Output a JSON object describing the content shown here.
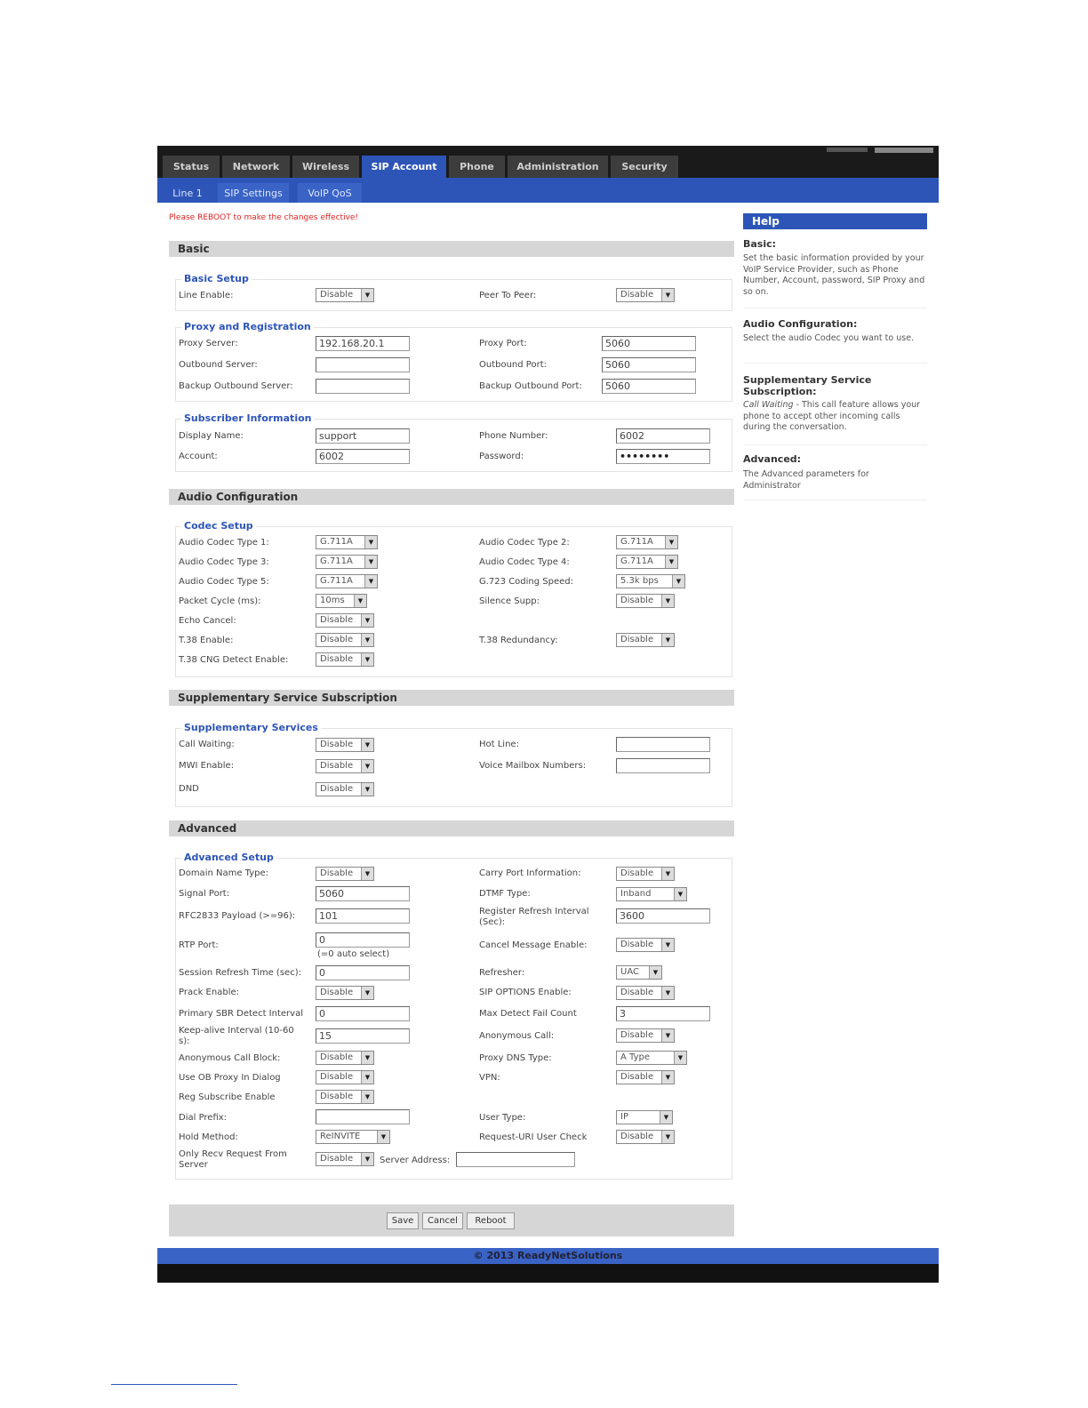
{
  "tabs": [
    "Status",
    "Network",
    "Wireless",
    "SIP Account",
    "Phone",
    "Administration",
    "Security"
  ],
  "subtabs": [
    "Line 1",
    "SIP Settings",
    "VoIP QoS"
  ],
  "notice": "Please REBOOT to make the changes effective!",
  "sections": {
    "basic": "Basic",
    "audio": "Audio Configuration",
    "supp": "Supplementary Service Subscription",
    "advanced": "Advanced"
  },
  "legends": {
    "basic_setup": "Basic Setup",
    "proxy_reg": "Proxy and Registration",
    "subscriber": "Subscriber Information",
    "codec": "Codec Setup",
    "supp_services": "Supplementary Services",
    "adv_setup": "Advanced Setup"
  },
  "basic_setup": {
    "line_enable_label": "Line Enable:",
    "line_enable": "Disable",
    "p2p_label": "Peer To Peer:",
    "p2p": "Disable"
  },
  "proxy": {
    "proxy_server_label": "Proxy Server:",
    "proxy_server": "192.168.20.1",
    "proxy_port_label": "Proxy Port:",
    "proxy_port": "5060",
    "outbound_server_label": "Outbound Server:",
    "outbound_server": "",
    "outbound_port_label": "Outbound Port:",
    "outbound_port": "5060",
    "backup_server_label": "Backup Outbound Server:",
    "backup_server": "",
    "backup_port_label": "Backup Outbound Port:",
    "backup_port": "5060"
  },
  "subscriber": {
    "display_name_label": "Display Name:",
    "display_name": "support",
    "phone_number_label": "Phone Number:",
    "phone_number": "6002",
    "account_label": "Account:",
    "account": "6002",
    "password_label": "Password:",
    "password": "••••••••"
  },
  "codec": {
    "c1_label": "Audio Codec Type 1:",
    "c1": "G.711A",
    "c2_label": "Audio Codec Type 2:",
    "c2": "G.711A",
    "c3_label": "Audio Codec Type 3:",
    "c3": "G.711A",
    "c4_label": "Audio Codec Type 4:",
    "c4": "G.711A",
    "c5_label": "Audio Codec Type 5:",
    "c5": "G.711A",
    "g723_label": "G.723 Coding Speed:",
    "g723": "5.3k bps",
    "packet_label": "Packet Cycle (ms):",
    "packet": "10ms",
    "silence_label": "Silence Supp:",
    "silence": "Disable",
    "echo_label": "Echo Cancel:",
    "echo": "Disable",
    "t38_label": "T.38 Enable:",
    "t38": "Disable",
    "t38red_label": "T.38 Redundancy:",
    "t38red": "Disable",
    "t38cng_label": "T.38 CNG Detect Enable:",
    "t38cng": "Disable"
  },
  "supp": {
    "cw_label": "Call Waiting:",
    "cw": "Disable",
    "hotline_label": "Hot Line:",
    "hotline": "",
    "mwi_label": "MWI Enable:",
    "mwi": "Disable",
    "vmb_label": "Voice Mailbox Numbers:",
    "vmb": "",
    "dnd_label": "DND",
    "dnd": "Disable"
  },
  "adv": {
    "dn_type_label": "Domain Name Type:",
    "dn_type": "Disable",
    "carry_port_label": "Carry Port Information:",
    "carry_port": "Disable",
    "signal_port_label": "Signal Port:",
    "signal_port": "5060",
    "dtmf_label": "DTMF Type:",
    "dtmf": "Inband",
    "rfc_label": "RFC2833 Payload (>=96):",
    "rfc": "101",
    "reg_refresh_label": "Register Refresh Interval (Sec):",
    "reg_refresh": "3600",
    "rtp_label": "RTP Port:",
    "rtp": "0",
    "rtp_hint": "(=0 auto select)",
    "cancel_msg_label": "Cancel Message Enable:",
    "cancel_msg": "Disable",
    "session_label": "Session Refresh Time (sec):",
    "session": "0",
    "refresher_label": "Refresher:",
    "refresher": "UAC",
    "prack_label": "Prack Enable:",
    "prack": "Disable",
    "sip_opt_label": "SIP OPTIONS Enable:",
    "sip_opt": "Disable",
    "sbr_label": "Primary SBR Detect Interval",
    "sbr": "0",
    "max_fail_label": "Max Detect Fail Count",
    "max_fail": "3",
    "keepalive_label": "Keep-alive Interval (10-60 s):",
    "keepalive": "15",
    "anon_call_label": "Anonymous Call:",
    "anon_call": "Disable",
    "anon_block_label": "Anonymous Call Block:",
    "anon_block": "Disable",
    "proxy_dns_label": "Proxy DNS Type:",
    "proxy_dns": "A Type",
    "ob_dialog_label": "Use OB Proxy In Dialog",
    "ob_dialog": "Disable",
    "vpn_label": "VPN:",
    "vpn": "Disable",
    "reg_sub_label": "Reg Subscribe Enable",
    "reg_sub": "Disable",
    "dial_prefix_label": "Dial Prefix:",
    "dial_prefix": "",
    "user_type_label": "User Type:",
    "user_type": "IP",
    "hold_label": "Hold Method:",
    "hold": "ReINVITE",
    "req_uri_label": "Request-URI User Check",
    "req_uri": "Disable",
    "only_recv_label": "Only Recv Request From Server",
    "only_recv": "Disable",
    "server_addr_label": "Server Address:",
    "server_addr": ""
  },
  "buttons": {
    "save": "Save",
    "cancel": "Cancel",
    "reboot": "Reboot"
  },
  "footer": "© 2013 ReadyNetSolutions",
  "help": {
    "title": "Help",
    "basic_title": "Basic:",
    "basic_text": "Set the basic information provided by your VoIP Service Provider, such as Phone Number, Account, password, SIP Proxy and so on.",
    "audio_title": "Audio Configuration:",
    "audio_text": "Select the audio Codec you want to use.",
    "supp_title": "Supplementary Service Subscription:",
    "supp_em": "Call Waiting",
    "supp_text": " - This call feature allows your phone to accept other incoming calls during the conversation.",
    "adv_title": "Advanced:",
    "adv_text": "The Advanced parameters for Administrator"
  },
  "colors": {
    "accent": "#2d55b8",
    "topbar": "#1a1a1a",
    "notice": "#dd2222",
    "section_bg": "#d6d6d6"
  }
}
